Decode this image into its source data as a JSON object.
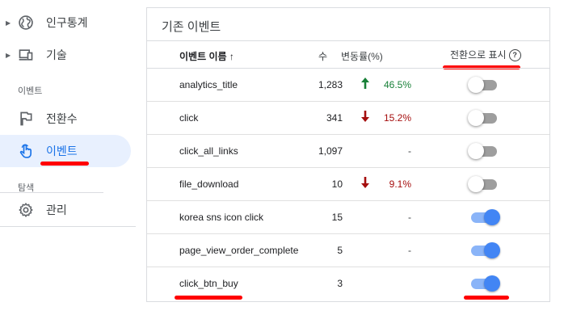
{
  "sidebar": {
    "items": [
      {
        "label": "인구통계",
        "icon": "globe-icon"
      },
      {
        "label": "기술",
        "icon": "devices-icon"
      }
    ],
    "section_events": "이벤트",
    "event_items": [
      {
        "label": "전환수",
        "icon": "flag-icon"
      },
      {
        "label": "이벤트",
        "icon": "touch-icon",
        "active": true
      }
    ],
    "section_explore": "탐색",
    "admin": {
      "label": "관리",
      "icon": "gear-icon"
    }
  },
  "card": {
    "title": "기존 이벤트",
    "columns": {
      "name": "이벤트 이름 ↑",
      "count": "수",
      "change": "변동률(%)",
      "conversion": "전환으로 표시",
      "help": "?"
    },
    "rows": [
      {
        "name": "analytics_title",
        "count": "1,283",
        "trend": "up",
        "change": "46.5%",
        "conversion": false
      },
      {
        "name": "click",
        "count": "341",
        "trend": "down",
        "change": "15.2%",
        "conversion": false
      },
      {
        "name": "click_all_links",
        "count": "1,097",
        "trend": "none",
        "change": "-",
        "conversion": false
      },
      {
        "name": "file_download",
        "count": "10",
        "trend": "down",
        "change": "9.1%",
        "conversion": false
      },
      {
        "name": "korea sns icon click",
        "count": "15",
        "trend": "none",
        "change": "-",
        "conversion": true
      },
      {
        "name": "page_view_order_complete",
        "count": "5",
        "trend": "none",
        "change": "-",
        "conversion": true
      },
      {
        "name": "click_btn_buy",
        "count": "3",
        "trend": "blank",
        "change": "",
        "conversion": true
      }
    ]
  },
  "colors": {
    "accent": "#1a73e8",
    "active_bg": "#e8f0fe",
    "toggle_on": "#4285f4",
    "trend_up": "#188038",
    "trend_down": "#a50e0e",
    "annotation": "#ff0000"
  }
}
